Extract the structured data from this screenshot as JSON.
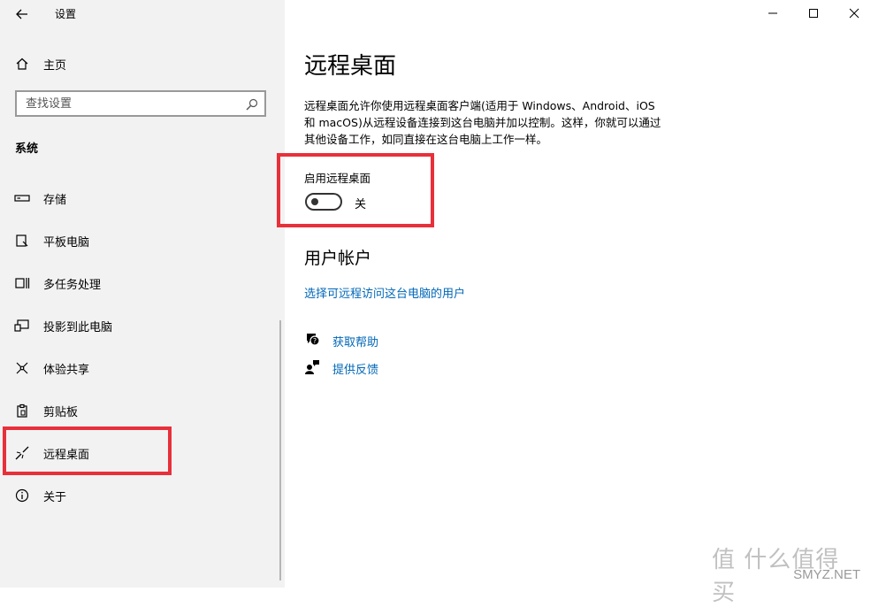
{
  "window": {
    "title": "设置",
    "controls": {
      "minimize": "minimize-icon",
      "maximize": "maximize-icon",
      "close": "close-icon"
    }
  },
  "sidebar": {
    "home_label": "主页",
    "search_placeholder": "查找设置",
    "section_title": "系统",
    "items": [
      {
        "label": "存储",
        "icon": "storage-icon"
      },
      {
        "label": "平板电脑",
        "icon": "tablet-icon"
      },
      {
        "label": "多任务处理",
        "icon": "multitasking-icon"
      },
      {
        "label": "投影到此电脑",
        "icon": "projecting-icon"
      },
      {
        "label": "体验共享",
        "icon": "shared-experiences-icon"
      },
      {
        "label": "剪贴板",
        "icon": "clipboard-icon"
      },
      {
        "label": "远程桌面",
        "icon": "remote-desktop-icon",
        "selected": true
      },
      {
        "label": "关于",
        "icon": "info-icon"
      }
    ]
  },
  "main": {
    "title": "远程桌面",
    "description_lines": [
      "远程桌面允许你使用远程桌面客户端(适用于 Windows、Android、iOS",
      "和 macOS)从远程设备连接到这台电脑并加以控制。这样，你就可以通过",
      "其他设备工作，如同直接在这台电脑上工作一样。"
    ],
    "toggle": {
      "label": "启用远程桌面",
      "state_label": "关",
      "on": false
    },
    "user_accounts": {
      "heading": "用户帐户",
      "link": "选择可远程访问这台电脑的用户"
    },
    "help_links": [
      {
        "label": "获取帮助",
        "icon": "get-help-icon"
      },
      {
        "label": "提供反馈",
        "icon": "feedback-icon"
      }
    ]
  },
  "watermark": {
    "text": "值 什么值得买",
    "sub": "SMYZ.NET"
  },
  "colors": {
    "sidebar_bg": "#f2f2f2",
    "link": "#0067b8",
    "highlight": "#e8303a"
  }
}
